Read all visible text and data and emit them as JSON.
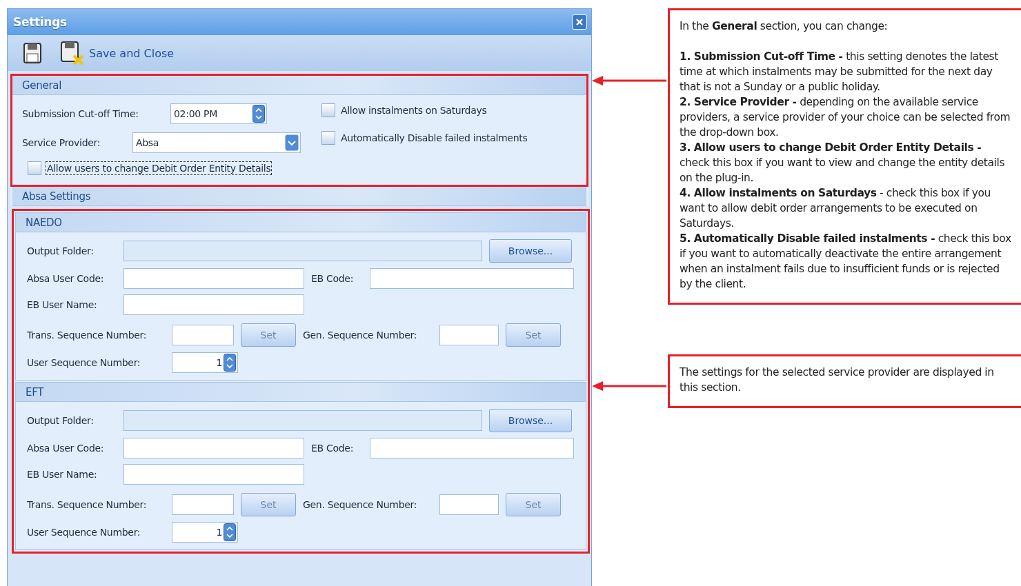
{
  "window": {
    "title": "Settings"
  },
  "toolbar": {
    "save_label": "Save and Close"
  },
  "general": {
    "title": "General",
    "highlighted": true,
    "cutoff": {
      "label": "Submission Cut-off Time:",
      "value": "02:00 PM"
    },
    "provider": {
      "label": "Service Provider:",
      "value": "Absa"
    },
    "checkboxes": [
      {
        "label": "Allow instalments on Saturdays",
        "checked": false,
        "focused": false
      },
      {
        "label": "Automatically Disable failed instalments",
        "checked": false,
        "focused": false
      },
      {
        "label": "Allow users to change Debit Order Entity Details",
        "checked": false,
        "focused": true
      }
    ]
  },
  "provider_settings": {
    "title": "Absa Settings",
    "highlighted": true,
    "groups": [
      {
        "title": "NAEDO",
        "output_folder": "Output Folder:",
        "browse": "Browse...",
        "user_code": "Absa User Code:",
        "eb_code": "EB Code:",
        "eb_user_name": "EB User Name:",
        "trans_seq": "Trans. Sequence Number:",
        "trans_set": {
          "label": "Set",
          "disabled": true
        },
        "gen_seq": "Gen. Sequence Number:",
        "gen_set": {
          "label": "Set",
          "disabled": true
        },
        "user_seq": {
          "label": "User Sequence Number:",
          "value": "1"
        }
      },
      {
        "title": "EFT",
        "output_folder": "Output Folder:",
        "browse": "Browse...",
        "user_code": "Absa User Code:",
        "eb_code": "EB Code:",
        "eb_user_name": "EB User Name:",
        "trans_seq": "Trans. Sequence Number:",
        "trans_set": {
          "label": "Set",
          "disabled": true
        },
        "gen_seq": "Gen. Sequence Number:",
        "gen_set": {
          "label": "Set",
          "disabled": true
        },
        "user_seq": {
          "label": "User Sequence Number:",
          "value": "1"
        }
      }
    ]
  },
  "callouts": [
    {
      "paragraphs": [
        "In the **General** section, you can change:",
        "**1. Submission Cut-off Time -** this setting denotes the latest time at which instalments may be submitted for the next day that is not a Sunday or a public holiday.\n**2. Service Provider -** depending on the available service providers, a service provider of your choice can be selected from the drop-down box.\n**3. Allow users to change Debit Order Entity Details -** check this box if you want to view and change the entity details on the plug-in.\n**4. Allow instalments on Saturdays** - check this box if you want to allow debit order arrangements to be executed on Saturdays.\n**5. Automatically Disable failed instalments -** check this box if you want to automatically deactivate the entire arrangement when an instalment fails due to insufficient funds or is rejected by the client."
      ]
    },
    {
      "paragraphs": [
        "The settings for the selected service provider are displayed in this section."
      ]
    }
  ]
}
